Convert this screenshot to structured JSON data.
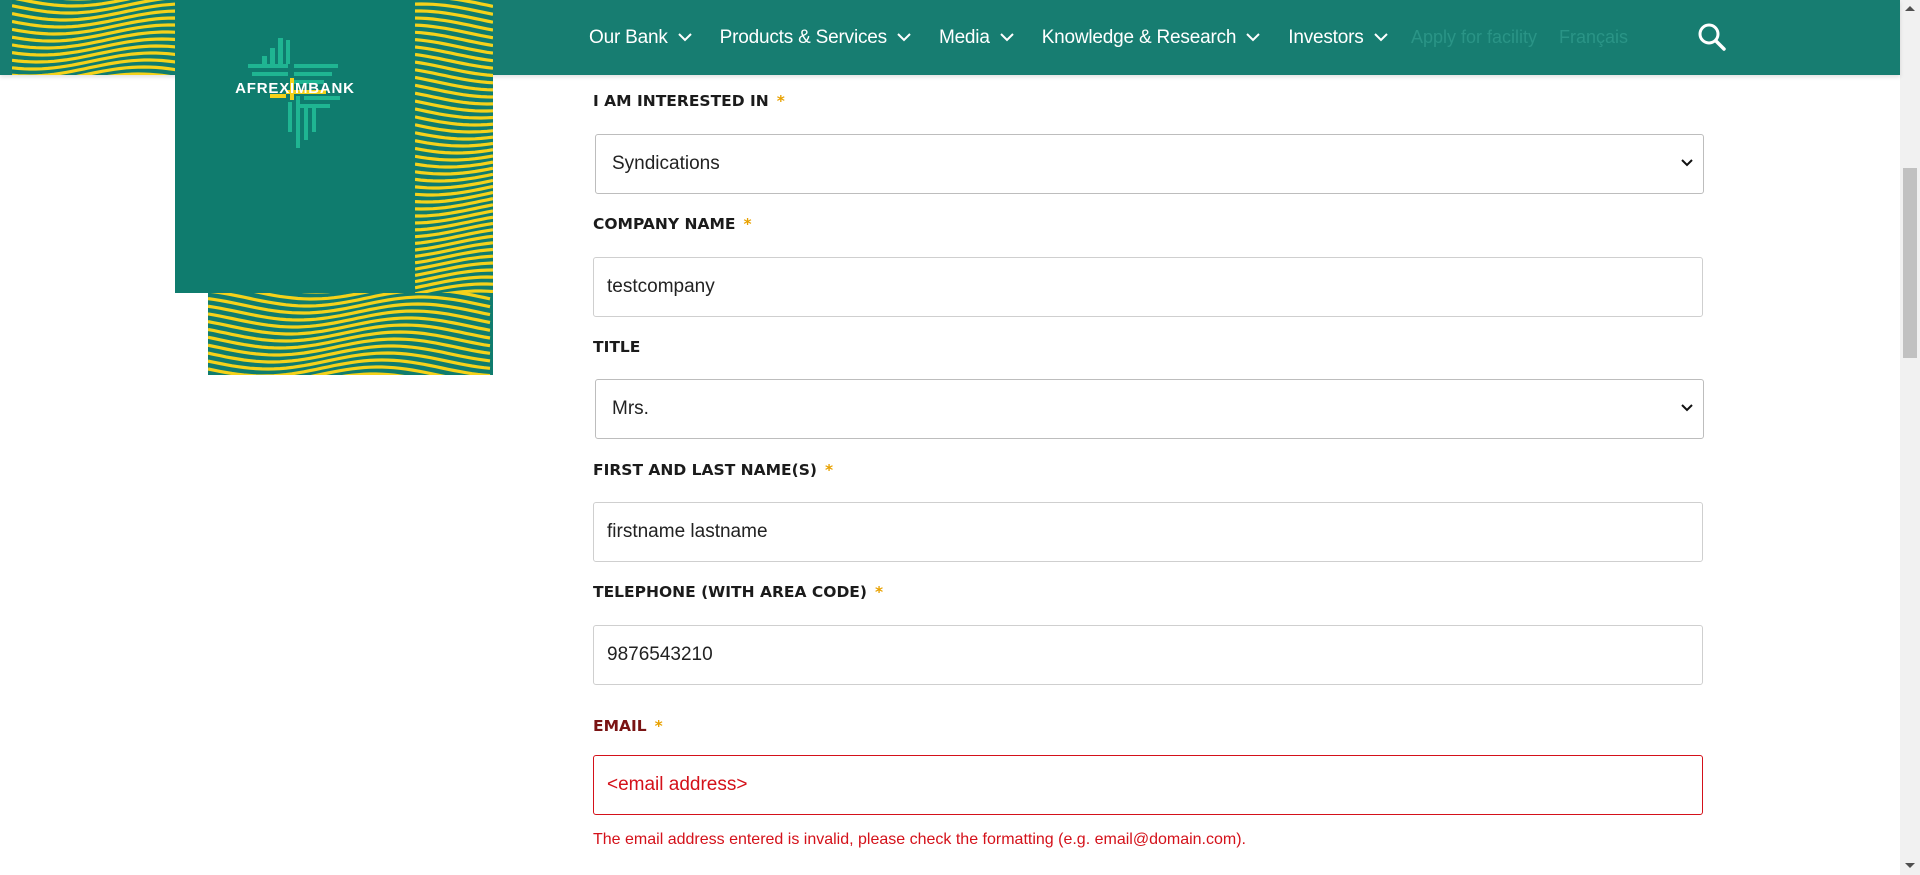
{
  "brand": {
    "logo_text": "AFREXIMBANK",
    "colors": {
      "nav_bg": "#177d71",
      "logo_bg": "#0f7c6e",
      "wave_yellow": "#f5d21a",
      "error": "#d4111a",
      "required": "#e8a100"
    }
  },
  "nav": {
    "items": [
      {
        "label": "Our Bank",
        "icon": "chevron-down-icon"
      },
      {
        "label": "Products & Services",
        "icon": "chevron-down-icon"
      },
      {
        "label": "Media",
        "icon": "chevron-down-icon"
      },
      {
        "label": "Knowledge & Research",
        "icon": "chevron-down-icon"
      },
      {
        "label": "Investors",
        "icon": "chevron-down-icon"
      }
    ],
    "apply_label": "Apply for facility",
    "language_label": "Français",
    "search_icon": "search-icon"
  },
  "form": {
    "interest": {
      "label": "I AM INTERESTED IN",
      "required": "*",
      "value": "Syndications"
    },
    "company": {
      "label": "COMPANY NAME",
      "required": "*",
      "value": "testcompany"
    },
    "title": {
      "label": "TITLE",
      "value": "Mrs."
    },
    "name": {
      "label": "FIRST AND LAST NAME(S)",
      "required": "*",
      "value": "firstname lastname"
    },
    "telephone": {
      "label": "TELEPHONE (WITH AREA CODE)",
      "required": "*",
      "value": "9876543210"
    },
    "email": {
      "label": "EMAIL",
      "required": "*",
      "value": "<email address>",
      "error": "The email address entered is invalid, please check the formatting (e.g. email@domain.com)."
    }
  }
}
